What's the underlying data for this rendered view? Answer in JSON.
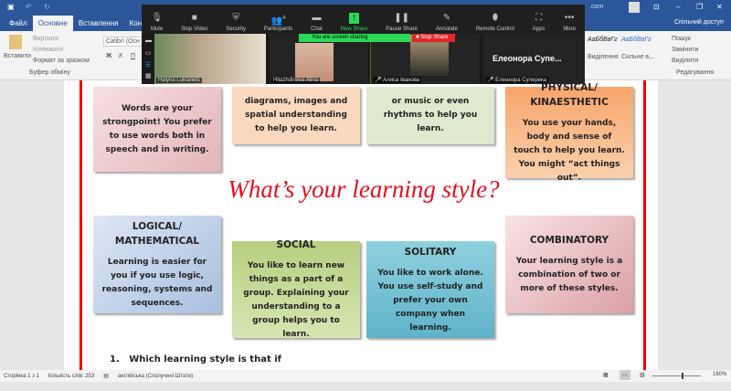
{
  "word": {
    "title": "Word",
    "account": ".com",
    "share": "Спільний доступ",
    "tabs": [
      "Файл",
      "Основне",
      "Вставлення",
      "Конструктор"
    ],
    "clipboard": {
      "paste": "Вставити",
      "cut": "Вирізати",
      "copy": "Копіювати",
      "format": "Формат за зразком",
      "group": "Буфер обміну"
    },
    "font": {
      "name": "Calibri (Осн",
      "bold": "Ж",
      "italic": "К",
      "underline": "П"
    },
    "styles": [
      "АаБбВвГг",
      "АаБбВвГг"
    ],
    "style_names": [
      "Виділення",
      "Сильне в..."
    ],
    "editing": {
      "find": "Пошук",
      "replace": "Замінити",
      "select": "Виділити",
      "group": "Редагування"
    },
    "status": {
      "page": "Сторінка 1 з 1",
      "words": "Кількість слів: 253",
      "lang": "англійська (Сполучені Штати)",
      "zoom": "160%"
    }
  },
  "zoom": {
    "toolbar": [
      "Mute",
      "Stop Video",
      "Security",
      "Participants",
      "Chat",
      "New Share",
      "Pause Share",
      "Annotate",
      "Remote Control",
      "Apps",
      "More"
    ],
    "participants_count": "4",
    "sharing_banner": "You are screen sharing",
    "stop_share": "Stop Share",
    "participants": [
      "Halyna Lukianets",
      "Hliazhdinova Alina",
      "Алиса Іванова",
      "Елеонора Сулерека"
    ],
    "active_name": "Елеонора Супе..."
  },
  "doc": {
    "title": "What’s your learning style?",
    "cards": [
      {
        "head": "",
        "body": "Words are your strongpoint! You prefer to use words both in speech and in writing."
      },
      {
        "head": "",
        "body": "diagrams, images and spatial understanding to help you learn."
      },
      {
        "head": "",
        "body": "or music or even rhythms to help you learn."
      },
      {
        "head": "PHYSICAL/ KINAESTHETIC",
        "body": "You use your hands, body and sense of touch to help you learn. You might “act things out”."
      },
      {
        "head": "LOGICAL/ MATHEMATICAL",
        "body": "Learning is easier for you if you use logic, reasoning, systems and sequences."
      },
      {
        "head": "SOCIAL",
        "body": "You like to learn new things as a part of a group. Explaining your understanding to a group helps you to learn."
      },
      {
        "head": "SOLITARY",
        "body": "You like to work alone. You use self-study and prefer your own company when learning."
      },
      {
        "head": "COMBINATORY",
        "body": "Your learning style is a combination of two or more of these styles."
      }
    ],
    "question": "1.   Which learning style is that if"
  }
}
